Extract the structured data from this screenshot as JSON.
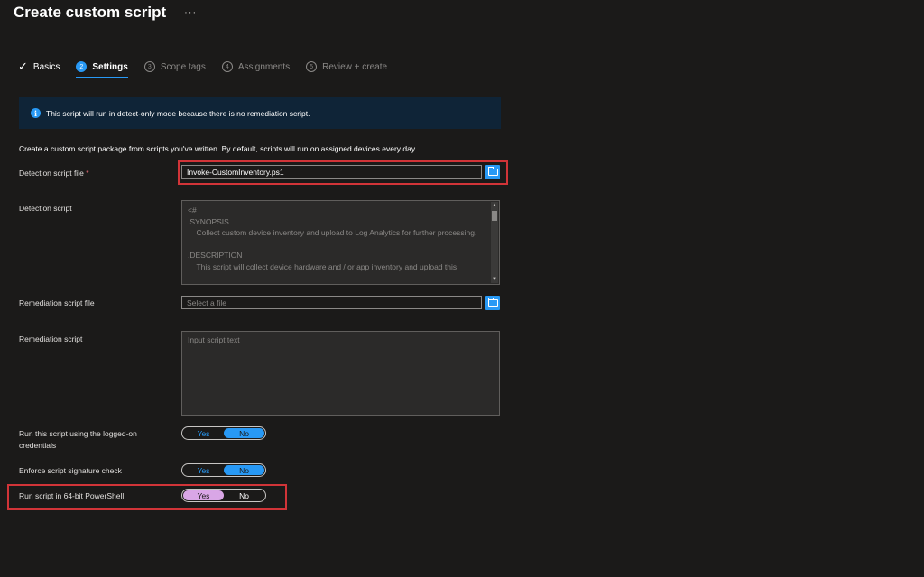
{
  "header": {
    "title": "Create custom script",
    "more": "···"
  },
  "tabs": [
    {
      "label": "Basics",
      "state": "done",
      "marker": "✓"
    },
    {
      "label": "Settings",
      "state": "active",
      "marker": "2"
    },
    {
      "label": "Scope tags",
      "state": "pending",
      "marker": "3"
    },
    {
      "label": "Assignments",
      "state": "pending",
      "marker": "4"
    },
    {
      "label": "Review + create",
      "state": "pending",
      "marker": "5"
    }
  ],
  "info": {
    "icon": "info-icon",
    "text": "This script will run in detect-only mode because there is no remediation script."
  },
  "description": "Create a custom script package from scripts you've written. By default, scripts will run on assigned devices every day.",
  "detection_file": {
    "label": "Detection script file",
    "required_mark": "*",
    "value": "Invoke-CustomInventory.ps1"
  },
  "detection_script": {
    "label": "Detection script",
    "lines": [
      "<#",
      ".SYNOPSIS",
      "    Collect custom device inventory and upload to Log Analytics for further processing.",
      "",
      ".DESCRIPTION",
      "    This script will collect device hardware and / or app inventory and upload this"
    ]
  },
  "remediation_file": {
    "label": "Remediation script file",
    "placeholder": "Select a file"
  },
  "remediation_script": {
    "label": "Remediation script",
    "placeholder": "Input script text"
  },
  "logged_on": {
    "label": "Run this script using the logged-on credentials",
    "yes": "Yes",
    "no": "No",
    "selected": "No"
  },
  "signature": {
    "label": "Enforce script signature check",
    "yes": "Yes",
    "no": "No",
    "selected": "No"
  },
  "run64": {
    "label": "Run script in 64-bit PowerShell",
    "yes": "Yes",
    "no": "No",
    "selected": "Yes"
  },
  "colors": {
    "accent": "#2899f5",
    "highlight_box": "#d13438",
    "selected_toggle": "#d9a6e6",
    "info_bg": "#0f2437"
  }
}
